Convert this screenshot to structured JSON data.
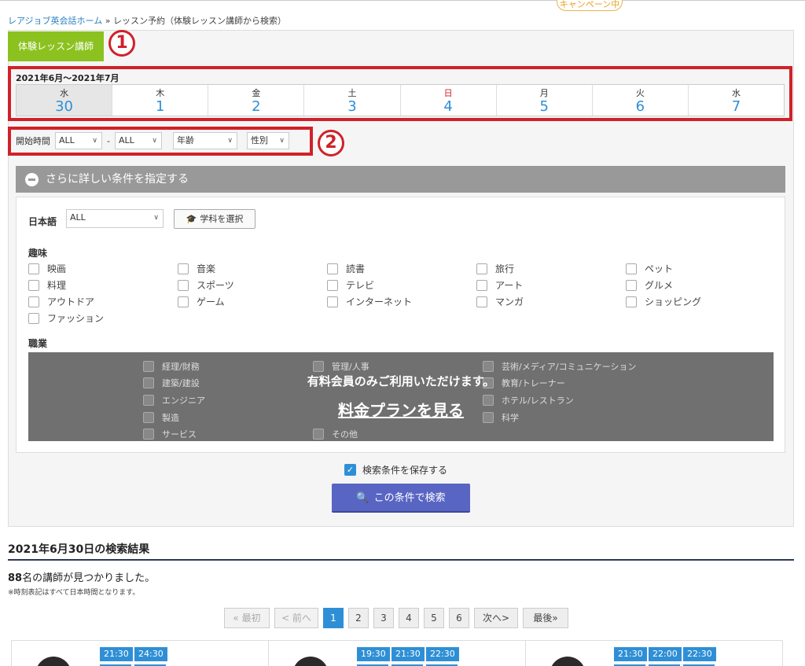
{
  "header": {
    "campaign_label": "キャンペーン中"
  },
  "breadcrumb": {
    "home": "レアジョブ英会話ホーム",
    "separator": "»",
    "current": "レッスン予約（体験レッスン講師から検索）"
  },
  "tab": {
    "label": "体験レッスン講師"
  },
  "annotations": {
    "one": "1",
    "two": "2"
  },
  "calendar": {
    "range": "2021年6月〜2021年7月",
    "days": [
      {
        "dow": "水",
        "num": "30"
      },
      {
        "dow": "木",
        "num": "1"
      },
      {
        "dow": "金",
        "num": "2"
      },
      {
        "dow": "土",
        "num": "3"
      },
      {
        "dow": "日",
        "num": "4"
      },
      {
        "dow": "月",
        "num": "5"
      },
      {
        "dow": "火",
        "num": "6"
      },
      {
        "dow": "水",
        "num": "7"
      }
    ]
  },
  "filters": {
    "start_label": "開始時間",
    "from": "ALL",
    "dash": "-",
    "to": "ALL",
    "age": "年齢",
    "gender": "性別"
  },
  "conditions": {
    "header": "さらに詳しい条件を指定する",
    "japanese_label": "日本語",
    "japanese_value": "ALL",
    "subject_button": "学科を選択",
    "hobby_label": "趣味",
    "hobbies": [
      "映画",
      "音楽",
      "読書",
      "旅行",
      "ペット",
      "料理",
      "スポーツ",
      "テレビ",
      "アート",
      "グルメ",
      "アウトドア",
      "ゲーム",
      "インターネット",
      "マンガ",
      "ショッピング",
      "ファッション"
    ],
    "job_label": "職業",
    "jobs": [
      "経理/財務",
      "管理/人事",
      "芸術/メディア/コミュニケーション",
      "建築/建設",
      "教育/トレーナー",
      "エンジニア",
      "ホテル/レストラン",
      "製造",
      "科学",
      "サービス",
      "その他"
    ],
    "locked_msg": "有料会員のみご利用いただけます。",
    "locked_link": "料金プランを見る"
  },
  "save": {
    "label": "検索条件を保存する",
    "check": "✓"
  },
  "search_button": {
    "label": "この条件で検索",
    "icon": "🔍"
  },
  "results": {
    "title": "2021年6月30日の検索結果",
    "count": "88",
    "count_suffix": "名の講師が見つかりました。",
    "note": "※時刻表記はすべて日本時間となります。"
  },
  "pager": {
    "first": "« 最初",
    "prev": "< 前へ",
    "pages": [
      "1",
      "2",
      "3",
      "4",
      "5",
      "6"
    ],
    "next": "次へ>",
    "last": "最後»"
  },
  "cards": [
    {
      "slots": [
        "21:30",
        "24:30"
      ]
    },
    {
      "slots": [
        "19:30",
        "21:30",
        "22:30"
      ]
    },
    {
      "slots": [
        "21:30",
        "22:00",
        "22:30"
      ]
    }
  ]
}
